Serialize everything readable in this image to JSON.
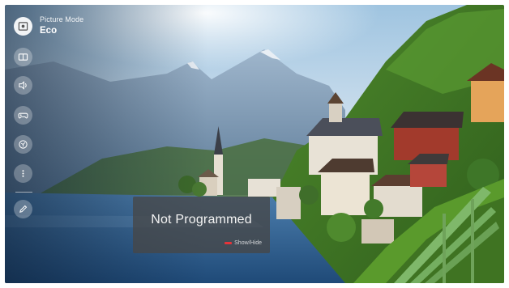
{
  "picture_mode": {
    "label": "Picture Mode",
    "value": "Eco"
  },
  "sidebar": {
    "items": [
      {
        "icon": "picture-mode-icon",
        "active": true
      },
      {
        "icon": "aspect-ratio-icon",
        "active": false
      },
      {
        "icon": "sound-icon",
        "active": false
      },
      {
        "icon": "game-controller-icon",
        "active": false
      },
      {
        "icon": "tv-channel-icon",
        "active": false
      },
      {
        "icon": "more-options-icon",
        "active": false
      },
      {
        "icon": "edit-icon",
        "active": false
      }
    ]
  },
  "popup": {
    "title": "Not Programmed",
    "hint_label": "Show/Hide",
    "hint_key_color": "#e5343a"
  }
}
